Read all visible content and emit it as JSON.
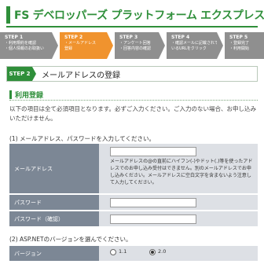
{
  "header": {
    "title": "FS デベロッパーズ プラットフォーム エクスプレス"
  },
  "steps": [
    {
      "num": "STEP 1",
      "lines": [
        "・利用規約を確認",
        "・個人情報のお取扱い"
      ],
      "state": "done"
    },
    {
      "num": "STEP 2",
      "lines": [
        "・メールアドレス",
        "  登録"
      ],
      "state": "current"
    },
    {
      "num": "STEP 3",
      "lines": [
        "・アンケート回答",
        "・回答内容の確認"
      ],
      "state": "todo"
    },
    {
      "num": "STEP 4",
      "lines": [
        "・確認メールに記載されて",
        "  いるURLをクリック"
      ],
      "state": "todo"
    },
    {
      "num": "STEP 5",
      "lines": [
        "・登録完了",
        "・利用開始"
      ],
      "state": "todo"
    }
  ],
  "stepbar": {
    "badge": "STEP 2",
    "label": "メールアドレスの登録"
  },
  "section": {
    "title": "利用登録",
    "intro": "以下の項目は全て必須項目となります。必ずご入力ください。ご入力のない場合、お申し込みいただけません。"
  },
  "question1": "(1) メールアドレス、パスワードを入力してください。",
  "form": {
    "email_label": "メールアドレス",
    "email_value": "",
    "email_note": "メールアドレスの@の直前にハイフン(-)やドット(.)等を使ったアドレスでのお申し込み受付はできません。別のメールアドレスでお申し込みください。メールアドレスに空白文字を含まないよう注意して入力してください。",
    "password_label": "パスワード",
    "password_value": "",
    "password_confirm_label": "パスワード（確認）",
    "password_confirm_value": ""
  },
  "question2": "(2) ASP.NETのバージョンを選んでください。",
  "version": {
    "label": "バージョン",
    "options": [
      "1.1",
      "2.0"
    ],
    "selected": "2.0"
  },
  "colors": {
    "brand_green": "#2f8f3a",
    "step_orange": "#f0932e",
    "step_gray": "#8f8f8f",
    "label_bg": "#7c8795",
    "value_bg": "#dde0e5"
  }
}
